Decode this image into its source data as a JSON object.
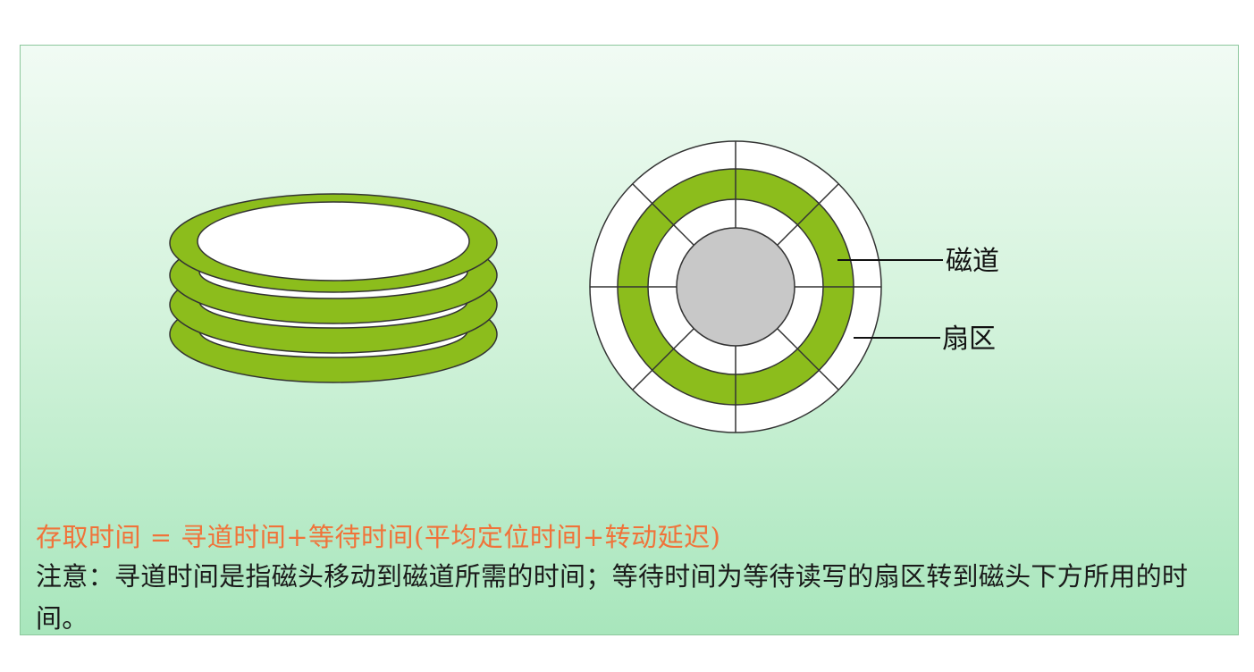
{
  "diagram": {
    "labels": {
      "track": "磁道",
      "sector": "扇区"
    }
  },
  "text": {
    "formula": "存取时间 = 寻道时间+等待时间(平均定位时间+转动延迟)",
    "note": "注意：寻道时间是指磁头移动到磁道所需的时间；等待时间为等待读写的扇区转到磁头下方所用的时间。"
  },
  "colors": {
    "track_green": "#8cbd1c",
    "hub_gray": "#c8c8c8",
    "formula_orange": "#f0733a",
    "panel_border": "#8cc79c"
  }
}
